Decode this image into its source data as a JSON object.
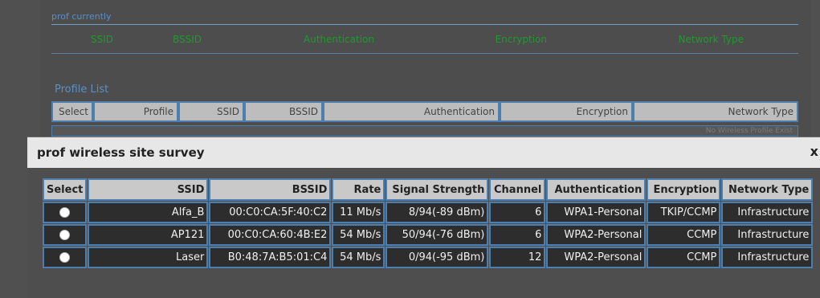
{
  "current": {
    "title": "prof currently",
    "columns": [
      "SSID",
      "BSSID",
      "Authentication",
      "Encryption",
      "Network Type"
    ]
  },
  "profile_list": {
    "title": "Profile List",
    "columns": [
      "Select",
      "Profile",
      "SSID",
      "BSSID",
      "Authentication",
      "Encryption",
      "Network Type"
    ],
    "empty_text": "No Wireless Profile Exist"
  },
  "dialog": {
    "title": "prof wireless site survey",
    "close_glyph": "x",
    "columns": {
      "select": "Select",
      "ssid": "SSID",
      "bssid": "BSSID",
      "rate": "Rate",
      "signal": "Signal Strength",
      "channel": "Channel",
      "auth": "Authentication",
      "enc": "Encryption",
      "nettype": "Network Type"
    },
    "rows": [
      {
        "ssid": "Alfa_B",
        "bssid": "00:C0:CA:5F:40:C2",
        "rate": "11 Mb/s",
        "signal": "8/94(-89 dBm)",
        "channel": "6",
        "auth": "WPA1-Personal",
        "enc": "TKIP/CCMP",
        "nettype": "Infrastructure"
      },
      {
        "ssid": "AP121",
        "bssid": "00:C0:CA:60:4B:E2",
        "rate": "54 Mb/s",
        "signal": "50/94(-76 dBm)",
        "channel": "6",
        "auth": "WPA2-Personal",
        "enc": "CCMP",
        "nettype": "Infrastructure"
      },
      {
        "ssid": "Laser",
        "bssid": "B0:48:7A:B5:01:C4",
        "rate": "54 Mb/s",
        "signal": "0/94(-95 dBm)",
        "channel": "12",
        "auth": "WPA2-Personal",
        "enc": "CCMP",
        "nettype": "Infrastructure"
      }
    ]
  }
}
